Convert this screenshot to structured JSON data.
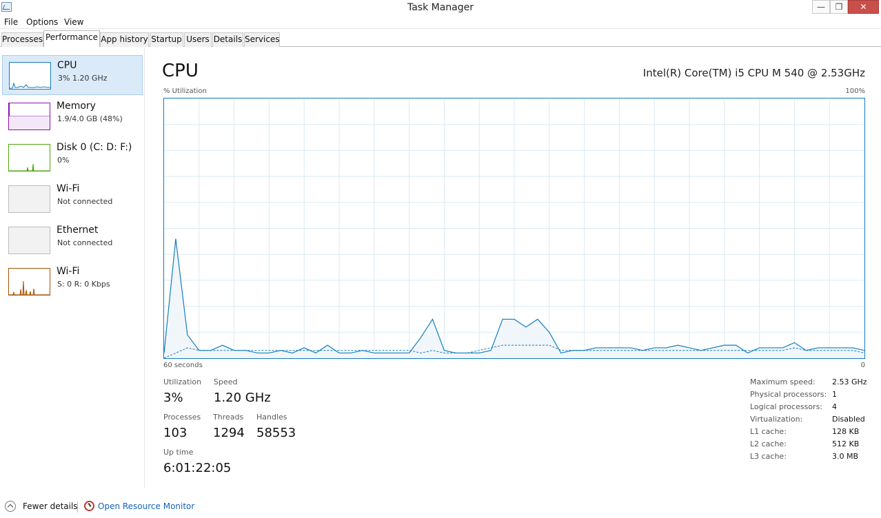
{
  "window": {
    "title": "Task Manager",
    "minimize": "—",
    "restore": "❐",
    "close": "✕"
  },
  "menu": [
    "File",
    "Options",
    "View"
  ],
  "tabs": [
    "Processes",
    "Performance",
    "App history",
    "Startup",
    "Users",
    "Details",
    "Services"
  ],
  "active_tab": "Performance",
  "sidebar": {
    "items": [
      {
        "name": "CPU",
        "sub": "3%  1.20 GHz",
        "color": "#117dbb"
      },
      {
        "name": "Memory",
        "sub": "1.9/4.0 GB (48%)",
        "color": "#8b12ae"
      },
      {
        "name": "Disk 0 (C: D: F:)",
        "sub": "0%",
        "color": "#4da60c"
      },
      {
        "name": "Wi-Fi",
        "sub": "Not connected",
        "color": "#bbbbbb"
      },
      {
        "name": "Ethernet",
        "sub": "Not connected",
        "color": "#bbbbbb"
      },
      {
        "name": "Wi-Fi",
        "sub": "S: 0  R: 0 Kbps",
        "color": "#a74f01"
      }
    ]
  },
  "header": {
    "title": "CPU",
    "model": "Intel(R) Core(TM) i5 CPU M 540 @ 2.53GHz"
  },
  "graph": {
    "ylabel": "% Utilization",
    "ymax_label": "100%",
    "xlabel_left": "60 seconds",
    "xlabel_right": "0",
    "line_color": "#117dbb",
    "grid_color": "#d9eaf4"
  },
  "chart_data": {
    "type": "area",
    "ylim": [
      0,
      100
    ],
    "series": [
      {
        "values": [
          2,
          46,
          9,
          3,
          3,
          5,
          3,
          3,
          2,
          2,
          3,
          2,
          4,
          2,
          5,
          2,
          2,
          3,
          2,
          2,
          2,
          2,
          8,
          15,
          3,
          2,
          2,
          2,
          3,
          15,
          15,
          12,
          15,
          10,
          2,
          3,
          3,
          4,
          4,
          4,
          4,
          3,
          4,
          4,
          5,
          4,
          3,
          4,
          5,
          5,
          2,
          4,
          4,
          4,
          6,
          3,
          4,
          4,
          4,
          4,
          3
        ]
      },
      {
        "values": [
          0,
          2,
          4,
          3,
          3,
          3,
          3,
          3,
          3,
          3,
          3,
          3,
          3,
          3,
          3,
          3,
          3,
          3,
          3,
          3,
          3,
          3,
          2,
          3,
          2,
          2,
          2,
          3,
          4,
          5,
          5,
          5,
          5,
          5,
          3,
          3,
          3,
          3,
          3,
          3,
          3,
          3,
          3,
          3,
          3,
          3,
          3,
          3,
          3,
          3,
          3,
          3,
          3,
          3,
          4,
          3,
          3,
          3,
          3,
          3,
          2
        ]
      }
    ],
    "grid": true
  },
  "stats": {
    "utilization_label": "Utilization",
    "utilization": "3%",
    "speed_label": "Speed",
    "speed": "1.20 GHz",
    "processes_label": "Processes",
    "processes": "103",
    "threads_label": "Threads",
    "threads": "1294",
    "handles_label": "Handles",
    "handles": "58553",
    "uptime_label": "Up time",
    "uptime": "6:01:22:05"
  },
  "info": [
    {
      "label": "Maximum speed:",
      "value": "2.53 GHz"
    },
    {
      "label": "Physical processors:",
      "value": "1"
    },
    {
      "label": "Logical processors:",
      "value": "4"
    },
    {
      "label": "Virtualization:",
      "value": "Disabled"
    },
    {
      "label": "L1 cache:",
      "value": "128 KB"
    },
    {
      "label": "L2 cache:",
      "value": "512 KB"
    },
    {
      "label": "L3 cache:",
      "value": "3.0 MB"
    }
  ],
  "footer": {
    "fewer": "Fewer details",
    "resmon": "Open Resource Monitor"
  }
}
